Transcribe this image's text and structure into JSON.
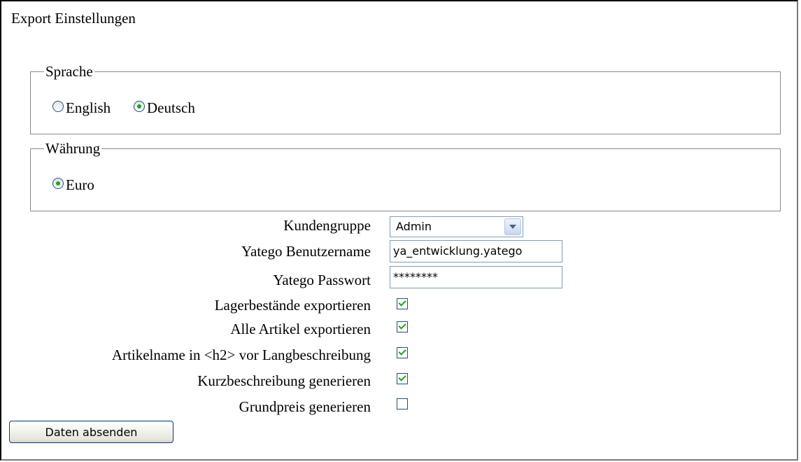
{
  "export_settings": {
    "legend": "Export Einstellungen",
    "language": {
      "legend": "Sprache",
      "options": [
        {
          "label": "English",
          "checked": false
        },
        {
          "label": "Deutsch",
          "checked": true
        }
      ]
    },
    "currency": {
      "legend": "Währung",
      "options": [
        {
          "label": "Euro",
          "checked": true
        }
      ]
    },
    "customer_group": {
      "label": "Kundengruppe",
      "value": "Admin"
    },
    "username": {
      "label": "Yatego Benutzername",
      "value": "ya_entwicklung.yatego"
    },
    "password": {
      "label": "Yatego Passwort",
      "value": "********"
    },
    "checkboxes": [
      {
        "label": "Lagerbestände exportieren",
        "checked": true
      },
      {
        "label": "Alle Artikel exportieren",
        "checked": true
      },
      {
        "label": "Artikelname in <h2> vor Langbeschreibung",
        "checked": true
      },
      {
        "label": "Kurzbeschreibung generieren",
        "checked": true
      },
      {
        "label": "Grundpreis generieren",
        "checked": false
      }
    ],
    "submit_label": "Daten absenden"
  }
}
